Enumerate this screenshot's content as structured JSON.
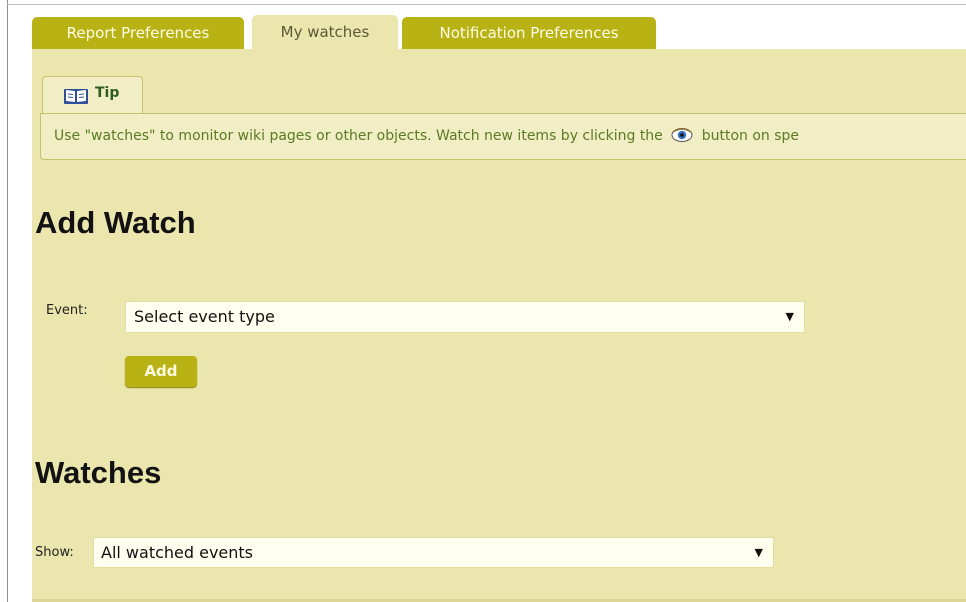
{
  "tabs": [
    {
      "label": "Report Preferences",
      "active": false
    },
    {
      "label": "My watches",
      "active": true
    },
    {
      "label": "Notification Preferences",
      "active": false
    }
  ],
  "tip": {
    "icon": "book-icon",
    "label": "Tip",
    "text_before": "Use \"watches\" to monitor wiki pages or other objects. Watch new items by clicking the",
    "inline_icon": "eye-icon",
    "text_after": "button on spe"
  },
  "add_watch": {
    "heading": "Add Watch",
    "event_label": "Event:",
    "event_select_value": "Select event type",
    "add_button_label": "Add"
  },
  "watches": {
    "heading": "Watches",
    "show_label": "Show:",
    "show_select_value": "All watched events"
  },
  "colors": {
    "tab_inactive": "#b8b214",
    "panel_bg": "#ebe6ae",
    "tip_bg": "#f1edc5",
    "tip_text": "#5b7b22",
    "button_bg": "#b8b214"
  }
}
